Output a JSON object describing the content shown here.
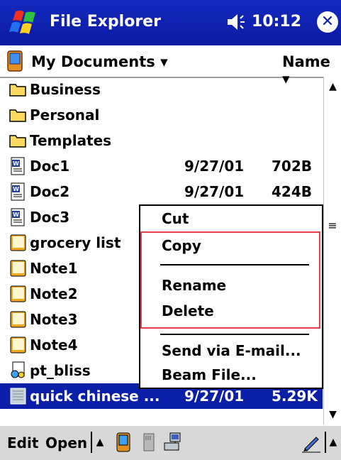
{
  "titlebar": {
    "app_title": "File Explorer",
    "clock": "10:12",
    "close_label": "✕",
    "icons": [
      "windows-start-icon",
      "speaker-icon"
    ]
  },
  "folderbar": {
    "folder": "My Documents ▾",
    "sort": "Name ▾"
  },
  "files": [
    {
      "name": "Business",
      "date": "",
      "size": "",
      "icon": "folder-icon"
    },
    {
      "name": "Personal",
      "date": "",
      "size": "",
      "icon": "folder-icon"
    },
    {
      "name": "Templates",
      "date": "",
      "size": "",
      "icon": "folder-icon"
    },
    {
      "name": "Doc1",
      "date": "9/27/01",
      "size": "702B",
      "icon": "word-doc-icon"
    },
    {
      "name": "Doc2",
      "date": "9/27/01",
      "size": "424B",
      "icon": "word-doc-icon"
    },
    {
      "name": "Doc3",
      "date": "",
      "size": "",
      "icon": "word-doc-icon"
    },
    {
      "name": "grocery list",
      "date": "",
      "size": "",
      "icon": "note-icon"
    },
    {
      "name": "Note1",
      "date": "",
      "size": "",
      "icon": "note-icon"
    },
    {
      "name": "Note2",
      "date": "",
      "size": "",
      "icon": "note-icon"
    },
    {
      "name": "Note3",
      "date": "",
      "size": "",
      "icon": "note-icon"
    },
    {
      "name": "Note4",
      "date": "",
      "size": "",
      "icon": "note-icon"
    },
    {
      "name": "pt_bliss",
      "date": "",
      "size": "",
      "icon": "image-file-icon"
    },
    {
      "name": "quick chinese ...",
      "date": "9/27/01",
      "size": "5.29K",
      "icon": "data-file-icon"
    }
  ],
  "context_menu": {
    "cut": "Cut",
    "copy": "Copy",
    "rename": "Rename",
    "delete": "Delete",
    "send": "Send via E-mail...",
    "beam": "Beam File..."
  },
  "bottombar": {
    "edit": "Edit",
    "open": "Open"
  },
  "colors": {
    "titlebar": "#0a1ea8",
    "selection": "#0a1ea8",
    "highlight_box": "#e8404a",
    "toolbar": "#d8d8d8"
  }
}
